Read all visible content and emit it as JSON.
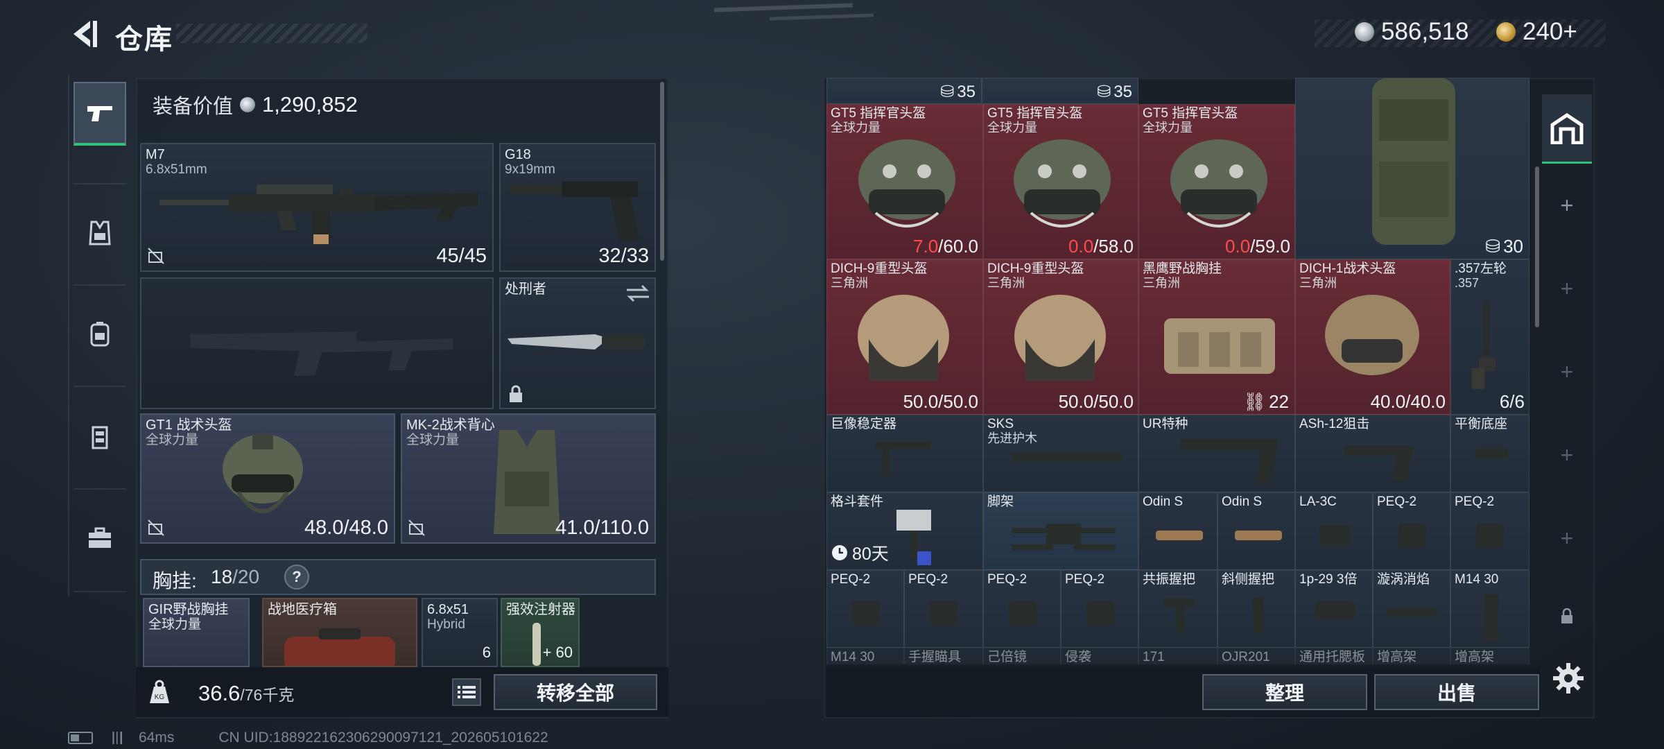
{
  "header": {
    "title": "仓库",
    "currency_silver": "586,518",
    "currency_gold": "240+"
  },
  "left_panel": {
    "value_label": "装备价值",
    "value_amount": "1,290,852",
    "slots": {
      "primary": {
        "name": "M7",
        "caliber": "6.8x51mm",
        "ammo": "45/45"
      },
      "secondary": {
        "name": "G18",
        "caliber": "9x19mm",
        "ammo": "32/33"
      },
      "melee": {
        "name": "处刑者"
      },
      "helmet": {
        "name": "GT1 战术头盔",
        "faction": "全球力量",
        "durability": "48.0/48.0"
      },
      "armor": {
        "name": "MK-2战术背心",
        "faction": "全球力量",
        "durability": "41.0/110.0"
      }
    },
    "chest": {
      "label": "胸挂:",
      "count": "18",
      "capacity": "/20",
      "help": "?"
    },
    "chest_items": [
      {
        "name": "GIR野战胸挂",
        "sub": "全球力量"
      },
      {
        "name": "战地医疗箱",
        "sub": ""
      },
      {
        "name": "6.8x51",
        "sub": "Hybrid",
        "count": "6"
      },
      {
        "name": "强效注射器",
        "sub": "",
        "count": "+ 60"
      }
    ],
    "weight": {
      "current": "36.6",
      "max": "/76千克"
    },
    "transfer_all": "转移全部"
  },
  "grid": {
    "row0": [
      {
        "cap": "35"
      },
      {
        "cap": "35"
      }
    ],
    "helmets_row": [
      {
        "name": "GT5 指挥官头盔",
        "sub": "全球力量",
        "dur_low": "7.0",
        "dur_max": "/60.0"
      },
      {
        "name": "GT5 指挥官头盔",
        "sub": "全球力量",
        "dur_low": "0.0",
        "dur_max": "/58.0"
      },
      {
        "name": "GT5 指挥官头盔",
        "sub": "全球力量",
        "dur_low": "0.0",
        "dur_max": "/59.0"
      }
    ],
    "backpack": {
      "cap": "30"
    },
    "row2": [
      {
        "name": "DICH-9重型头盔",
        "sub": "三角洲",
        "dur": "50.0/50.0"
      },
      {
        "name": "DICH-9重型头盔",
        "sub": "三角洲",
        "dur": "50.0/50.0"
      },
      {
        "name": "黑鹰野战胸挂",
        "sub": "三角洲",
        "cap": "22"
      },
      {
        "name": "DICH-1战术头盔",
        "sub": "三角洲",
        "dur": "40.0/40.0"
      },
      {
        "name": ".357左轮",
        "sub": ".357",
        "dur": "6/6"
      }
    ],
    "row3": [
      {
        "name": "巨像稳定器",
        "sub": ""
      },
      {
        "name": "SKS",
        "sub": "先进护木"
      },
      {
        "name": "UR特种",
        "sub": ""
      },
      {
        "name": "ASh-12狙击",
        "sub": ""
      },
      {
        "name": "平衡底座",
        "sub": ""
      }
    ],
    "row4": [
      {
        "name": "格斗套件",
        "timer": "80天"
      },
      {
        "name": "脚架"
      },
      {
        "name": "Odin S"
      },
      {
        "name": "Odin S"
      },
      {
        "name": "LA-3C"
      },
      {
        "name": "PEQ-2"
      },
      {
        "name": "PEQ-2"
      }
    ],
    "row5": [
      {
        "name": "PEQ-2"
      },
      {
        "name": "PEQ-2"
      },
      {
        "name": "PEQ-2"
      },
      {
        "name": "PEQ-2"
      },
      {
        "name": "共振握把"
      },
      {
        "name": "斜侧握把"
      },
      {
        "name": "1p-29 3倍"
      },
      {
        "name": "漩涡消焰"
      },
      {
        "name": "M14 30"
      }
    ],
    "row6": [
      {
        "name": "M14 30"
      },
      {
        "name": "手握瞄具"
      },
      {
        "name": "己倍镜"
      },
      {
        "name": "侵袭"
      },
      {
        "name": "171"
      },
      {
        "name": "OJR201"
      },
      {
        "name": "通用托腮板"
      },
      {
        "name": "增高架"
      },
      {
        "name": "增高架"
      }
    ]
  },
  "actions": {
    "sort": "整理",
    "sell": "出售"
  },
  "status": {
    "ping": "64ms",
    "uid": "CN UID:1889221623062900971​21_202605101622"
  }
}
